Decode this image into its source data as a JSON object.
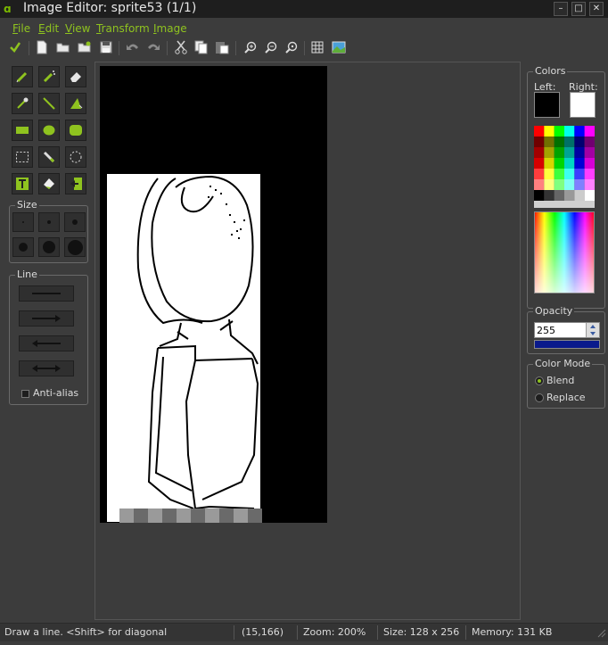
{
  "window": {
    "title": "Image Editor: sprite53 (1/1)",
    "logo_glyph": "ɑ",
    "minimize_glyph": "–",
    "maximize_glyph": "□",
    "close_glyph": "✕"
  },
  "menu": [
    "File",
    "Edit",
    "View",
    "Transform",
    "Image"
  ],
  "toolbar": {
    "icons": [
      "check-icon",
      "new-file-icon",
      "open-folder-icon",
      "open-file-icon",
      "save-icon",
      "undo-icon",
      "redo-icon",
      "cut-icon",
      "copy-icon",
      "paste-icon",
      "zoom-in-icon",
      "zoom-out-icon",
      "zoom-reset-icon",
      "grid-icon",
      "image-preview-icon"
    ]
  },
  "tools": {
    "icons": [
      "pencil-icon",
      "spray-icon",
      "eraser-icon",
      "color-picker-icon",
      "line-icon",
      "polygon-icon",
      "rectangle-icon",
      "ellipse-icon",
      "rounded-rect-icon",
      "select-rect-icon",
      "magic-wand-icon",
      "select-ellipse-icon",
      "text-icon",
      "fill-icon",
      "replace-color-icon"
    ]
  },
  "size": {
    "label": "Size",
    "levels": [
      1,
      2,
      3,
      4,
      5,
      6
    ]
  },
  "line": {
    "label": "Line",
    "styles": [
      "plain-line-icon",
      "arrow-right-icon",
      "arrow-left-icon",
      "arrow-both-icon"
    ],
    "antialias_label": "Anti-alias",
    "antialias_checked": false
  },
  "colors": {
    "label": "Colors",
    "left_label": "Left:",
    "right_label": "Right:",
    "left_color": "#000000",
    "right_color": "#ffffff"
  },
  "opacity": {
    "label": "Opacity",
    "value": "255",
    "bar_color": "#0a1a8c"
  },
  "color_mode": {
    "label": "Color Mode",
    "options": [
      "Blend",
      "Replace"
    ],
    "selected": "Blend"
  },
  "status": {
    "hint": "Draw a line. <Shift> for diagonal",
    "coords": "(15,166)",
    "zoom": "Zoom: 200%",
    "size": "Size: 128 x 256",
    "memory": "Memory: 131 KB"
  },
  "accent": "#8fc31f"
}
